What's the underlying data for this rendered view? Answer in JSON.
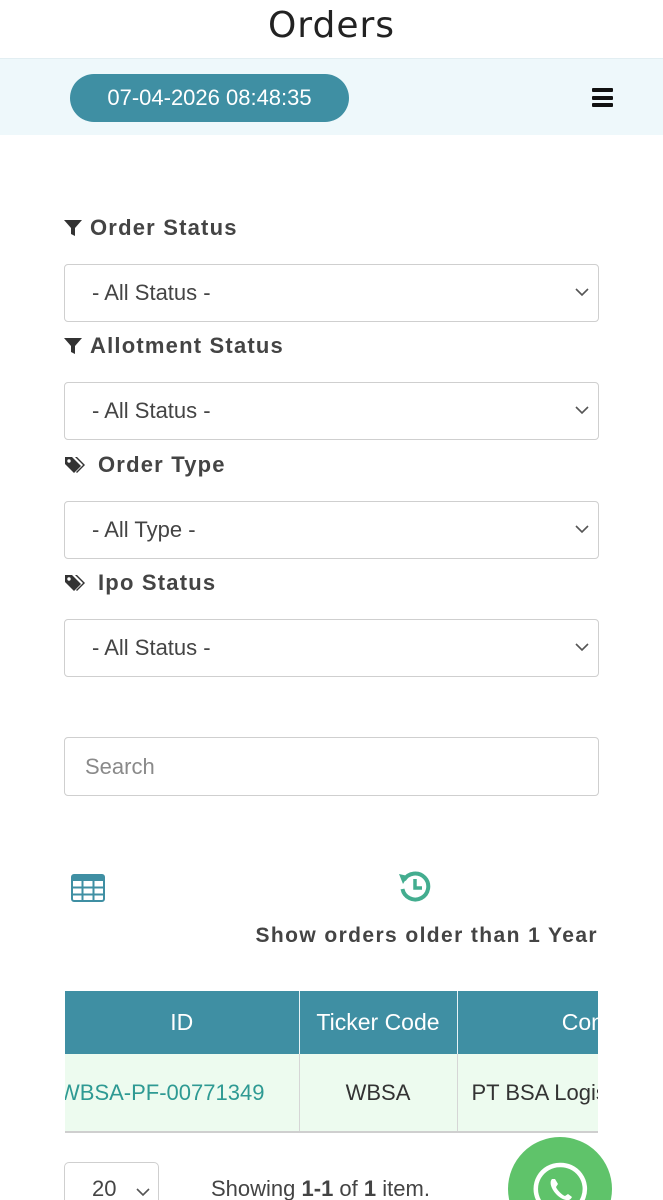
{
  "header": {
    "title": "Orders",
    "datetime": "07-04-2026 08:48:35"
  },
  "filters": {
    "order_status": {
      "label": "Order Status",
      "value": "- All Status -"
    },
    "allotment_status": {
      "label": "Allotment Status",
      "value": "- All Status -"
    },
    "order_type": {
      "label": "Order Type",
      "value": "- All Type -"
    },
    "ipo_status": {
      "label": "Ipo Status",
      "value": "- All Status -"
    }
  },
  "search": {
    "placeholder": "Search"
  },
  "actions": {
    "older_orders_label": "Show orders older than 1 Year"
  },
  "table": {
    "columns": [
      "ID",
      "Ticker Code",
      "Company"
    ],
    "rows": [
      {
        "id": "WBSA-PF-00771349",
        "ticker": "WBSA",
        "company": "PT BSA Logistics"
      }
    ]
  },
  "pagination": {
    "page_size": "20",
    "showing_prefix": "Showing ",
    "range": "1-1",
    "of_text": " of ",
    "total": "1",
    "suffix": " item."
  },
  "colors": {
    "primary": "#3f8fa3",
    "header_strip": "#eef8fb",
    "row_bg": "#edfbef",
    "link": "#2e9a93",
    "whatsapp": "#5fc36a"
  },
  "icons": {
    "filter": "filter-icon",
    "tags": "tags-icon",
    "table": "table-icon",
    "history": "history-icon",
    "menu": "hamburger-icon",
    "chat": "whatsapp-icon"
  }
}
